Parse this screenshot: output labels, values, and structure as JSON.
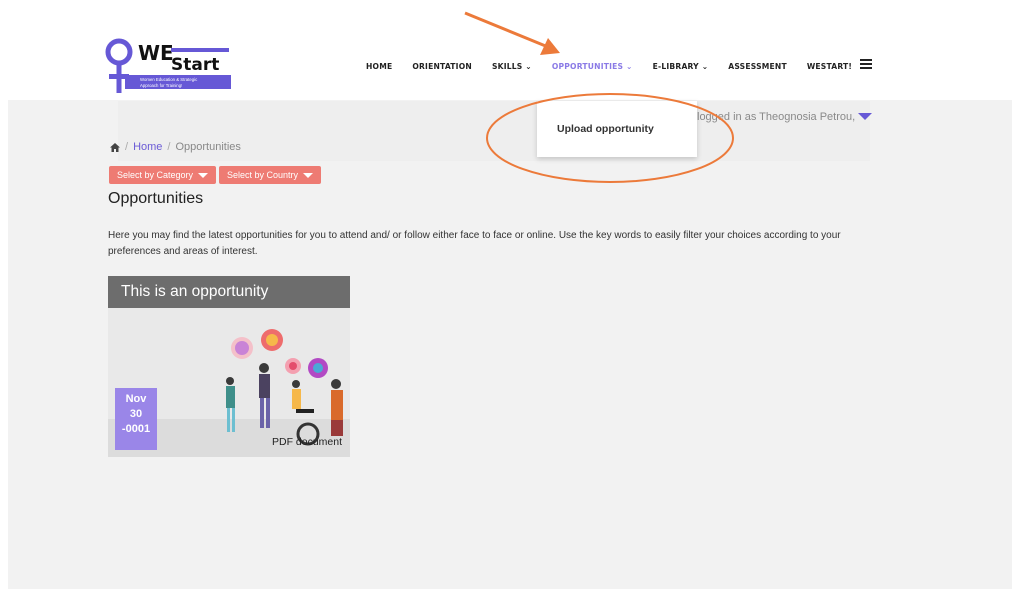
{
  "header": {
    "logo": {
      "brand": "WE",
      "sub": "Start",
      "tagline_1": "Women Education & Strategic",
      "tagline_2": "Approach for Training!"
    },
    "nav": [
      {
        "label": "HOME",
        "active": false
      },
      {
        "label": "ORIENTATION",
        "active": false
      },
      {
        "label": "SKILLS ⌄",
        "active": false
      },
      {
        "label": "OPPORTUNITIES ⌄",
        "active": true
      },
      {
        "label": "E-LIBRARY ⌄",
        "active": false
      },
      {
        "label": "ASSESSMENT",
        "active": false
      },
      {
        "label": "WESTART!",
        "active": false
      }
    ],
    "menu_icon": "hamburger-icon"
  },
  "dropdown": {
    "item": "Upload opportunity"
  },
  "user": {
    "logged_in_text": "logged in as Theognosia Petrou,"
  },
  "breadcrumb": {
    "home": "Home",
    "current": "Opportunities"
  },
  "filters": {
    "category": "Select by Category",
    "country": "Select by Country"
  },
  "page": {
    "title": "Opportunities",
    "intro": "Here you may find the latest opportunities for you to attend and/ or follow either face to face or online. Use the key words to easily filter your choices according to your preferences and areas of interest."
  },
  "card": {
    "title": "This is an opportunity",
    "date": {
      "month": "Nov",
      "day": "30",
      "year": "-0001"
    },
    "doc_label": "PDF document"
  },
  "colors": {
    "accent": "#8a7ae6",
    "filter": "#ee7b73",
    "badge": "#9a86e8",
    "annotation": "#ec7a3a",
    "brand": "#6658d6"
  }
}
